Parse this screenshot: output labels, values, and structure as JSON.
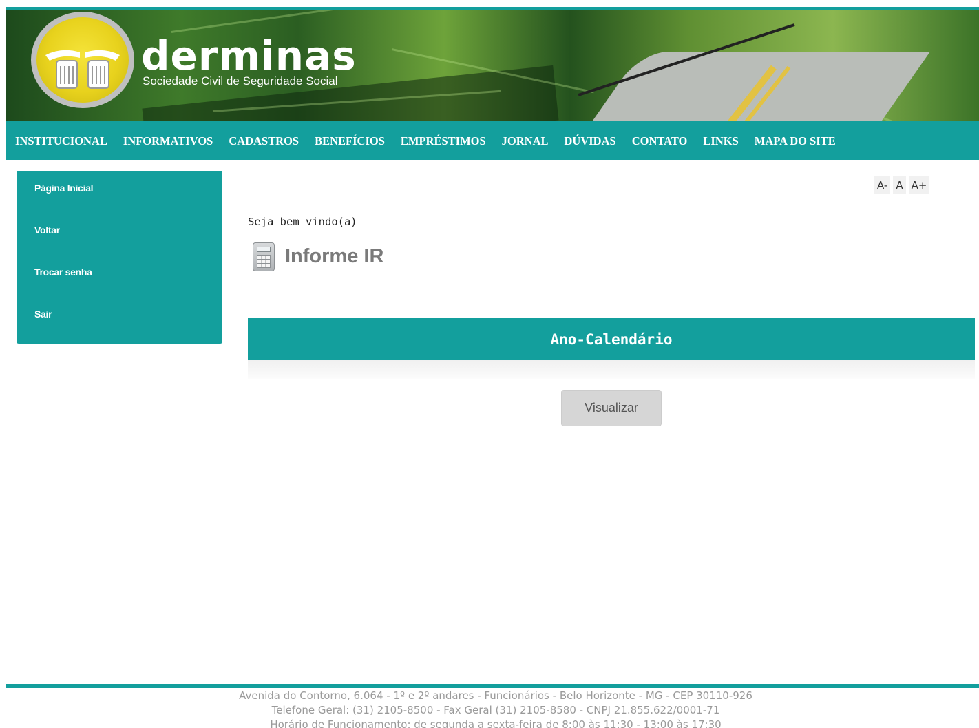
{
  "header": {
    "brand": "Derminas",
    "tagline": "Sociedade Civil de Seguridade Social",
    "logo_icon": "hands-icon"
  },
  "nav": {
    "items": [
      {
        "label": "INSTITUCIONAL"
      },
      {
        "label": "INFORMATIVOS"
      },
      {
        "label": "CADASTROS"
      },
      {
        "label": "BENEFÍCIOS"
      },
      {
        "label": "EMPRÉSTIMOS"
      },
      {
        "label": "JORNAL"
      },
      {
        "label": "DÚVIDAS"
      },
      {
        "label": "CONTATO"
      },
      {
        "label": "LINKS"
      },
      {
        "label": "MAPA DO SITE"
      }
    ]
  },
  "sidebar": {
    "items": [
      {
        "label": "Página Inicial"
      },
      {
        "label": "Voltar"
      },
      {
        "label": "Trocar senha"
      },
      {
        "label": "Sair"
      }
    ]
  },
  "font_controls": {
    "decrease": "A-",
    "reset": "A",
    "increase": "A+"
  },
  "main": {
    "welcome": "Seja bem vindo(a)",
    "section_title": "Informe IR",
    "section_icon": "calculator-icon",
    "year_header": "Ano-Calendário",
    "view_button": "Visualizar"
  },
  "footer": {
    "address": "Avenida do Contorno, 6.064 - 1º e 2º andares - Funcionários - Belo Horizonte - MG - CEP 30110-926",
    "phones": "Telefone Geral: (31) 2105-8500 - Fax Geral (31) 2105-8580 - CNPJ 21.855.622/0001-71",
    "hours": "Horário de Funcionamento: de segunda a sexta-feira de 8:00 às 11:30 - 13:00 às 17:30"
  },
  "colors": {
    "accent": "#139f9d",
    "logo_yellow": "#e8d21d",
    "button_gray": "#d6d6d6"
  }
}
